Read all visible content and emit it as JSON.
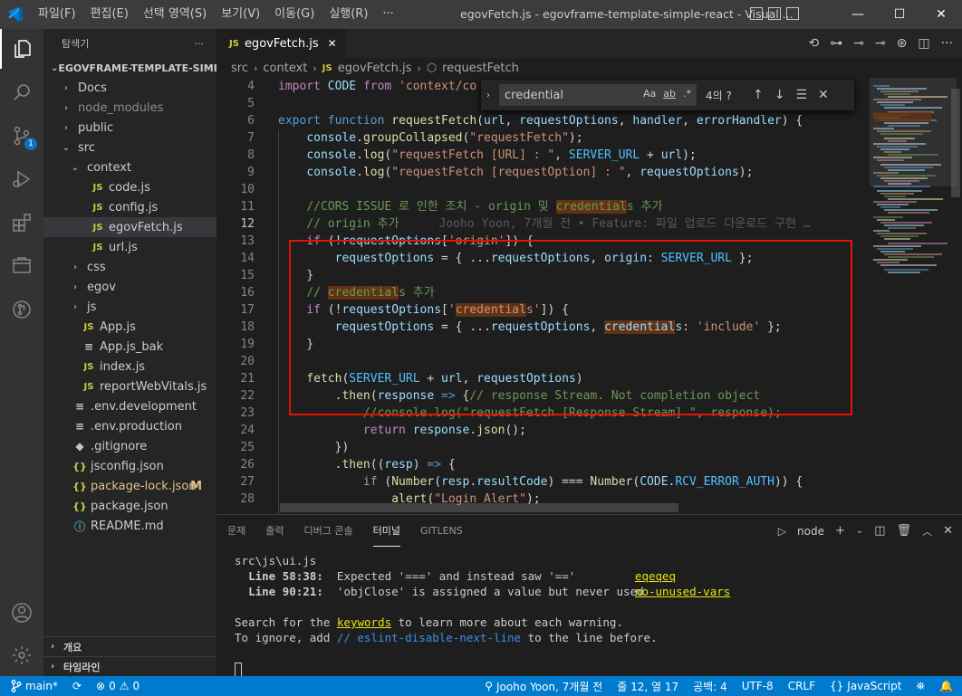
{
  "titlebar": {
    "menu": [
      "파일(F)",
      "편집(E)",
      "선택 영역(S)",
      "보기(V)",
      "이동(G)",
      "실행(R)",
      "···"
    ],
    "title": "egovFetch.js - egovframe-template-simple-react - Visual ...",
    "minimize": "—",
    "maximize": "☐",
    "close": "✕"
  },
  "explorer": {
    "header": "탐색기",
    "more": "···",
    "root": "EGOVFRAME-TEMPLATE-SIMP...",
    "items": [
      {
        "label": "Docs",
        "depth": 1,
        "kind": "folder-closed"
      },
      {
        "label": "node_modules",
        "depth": 1,
        "kind": "folder-closed",
        "dim": true
      },
      {
        "label": "public",
        "depth": 1,
        "kind": "folder-closed"
      },
      {
        "label": "src",
        "depth": 1,
        "kind": "folder-open"
      },
      {
        "label": "context",
        "depth": 2,
        "kind": "folder-open"
      },
      {
        "label": "code.js",
        "depth": 3,
        "kind": "js",
        "icon": "JS"
      },
      {
        "label": "config.js",
        "depth": 3,
        "kind": "js",
        "icon": "JS"
      },
      {
        "label": "egovFetch.js",
        "depth": 3,
        "kind": "js",
        "icon": "JS",
        "selected": true
      },
      {
        "label": "url.js",
        "depth": 3,
        "kind": "js",
        "icon": "JS"
      },
      {
        "label": "css",
        "depth": 2,
        "kind": "folder-closed"
      },
      {
        "label": "egov",
        "depth": 2,
        "kind": "folder-closed"
      },
      {
        "label": "js",
        "depth": 2,
        "kind": "folder-closed"
      },
      {
        "label": "App.js",
        "depth": 2,
        "kind": "js",
        "icon": "JS"
      },
      {
        "label": "App.js_bak",
        "depth": 2,
        "kind": "lines",
        "icon": "≡"
      },
      {
        "label": "index.js",
        "depth": 2,
        "kind": "js",
        "icon": "JS"
      },
      {
        "label": "reportWebVitals.js",
        "depth": 2,
        "kind": "js",
        "icon": "JS"
      },
      {
        "label": ".env.development",
        "depth": 1,
        "kind": "lines",
        "icon": "≡"
      },
      {
        "label": ".env.production",
        "depth": 1,
        "kind": "lines",
        "icon": "≡"
      },
      {
        "label": ".gitignore",
        "depth": 1,
        "kind": "lines",
        "icon": "◆"
      },
      {
        "label": "jsconfig.json",
        "depth": 1,
        "kind": "json",
        "icon": "{}"
      },
      {
        "label": "package-lock.json",
        "depth": 1,
        "kind": "json",
        "icon": "{}",
        "modified": true,
        "mark": "M"
      },
      {
        "label": "package.json",
        "depth": 1,
        "kind": "json",
        "icon": "{}"
      },
      {
        "label": "README.md",
        "depth": 1,
        "kind": "info",
        "icon": "ⓘ"
      }
    ],
    "outline": "개요",
    "timeline": "타임라인"
  },
  "activity": {
    "scm_badge": "1"
  },
  "editor": {
    "tab_icon": "JS",
    "tab_label": "egovFetch.js",
    "tab_close": "✕",
    "breadcrumb": {
      "folder1": "src",
      "folder2": "context",
      "file_icon": "JS",
      "file": "egovFetch.js",
      "symbol_icon": "⬡",
      "symbol": "requestFetch"
    },
    "tab_actions": [
      "⟲",
      "⊶",
      "⊸",
      "⊸",
      "⊛",
      "◫",
      "···"
    ]
  },
  "find": {
    "value": "credential",
    "case": "Aa",
    "word": "ab",
    "regex": ".*",
    "count": "4의 ?",
    "prev": "↑",
    "next": "↓",
    "selection": "☰",
    "close": "✕"
  },
  "code": {
    "lines": [
      {
        "n": "4",
        "html": "<span class='kc'>import</span> <span class='vr'>CODE</span> <span class='kc'>from</span> <span class='st'>'context/co</span>"
      },
      {
        "n": "5",
        "html": ""
      },
      {
        "n": "6",
        "html": "<span class='kw'>export</span> <span class='kw'>function</span> <span class='fn'>requestFetch</span><span class='pl'>(</span><span class='vr'>url</span><span class='pl'>, </span><span class='vr'>requestOptions</span><span class='pl'>, </span><span class='vr'>handler</span><span class='pl'>, </span><span class='vr'>errorHandler</span><span class='pl'>) {</span>"
      },
      {
        "n": "7",
        "html": "    <span class='vr'>console</span><span class='pl'>.</span><span class='fn'>groupCollapsed</span><span class='pl'>(</span><span class='st'>\"requestFetch\"</span><span class='pl'>);</span>"
      },
      {
        "n": "8",
        "html": "    <span class='vr'>console</span><span class='pl'>.</span><span class='fn'>log</span><span class='pl'>(</span><span class='st'>\"requestFetch [URL] : \"</span><span class='pl'>, </span><span class='cn'>SERVER_URL</span><span class='pl'> + </span><span class='vr'>url</span><span class='pl'>);</span>"
      },
      {
        "n": "9",
        "html": "    <span class='vr'>console</span><span class='pl'>.</span><span class='fn'>log</span><span class='pl'>(</span><span class='st'>\"requestFetch [requestOption] : \"</span><span class='pl'>, </span><span class='vr'>requestOptions</span><span class='pl'>);</span>"
      },
      {
        "n": "10",
        "html": ""
      },
      {
        "n": "11",
        "html": "    <span class='cm'>//CORS ISSUE 로 인한 조치 - origin 및 <span class='hl'>credential</span>s 추가</span>"
      },
      {
        "n": "12",
        "html": "    <span class='cm'>// origin 추가</span><span class='blame'>Jooho Yoon, 7개월 전 • Feature: 파일 업로드 다운로드 구현 …</span>",
        "cur": true
      },
      {
        "n": "13",
        "html": "    <span class='kc'>if</span><span class='pl'> (!</span><span class='vr'>requestOptions</span><span class='pl'>[</span><span class='st'>'origin'</span><span class='pl'>]) {</span>"
      },
      {
        "n": "14",
        "html": "        <span class='vr'>requestOptions</span><span class='pl'> = { ...</span><span class='vr'>requestOptions</span><span class='pl'>, </span><span class='vr'>origin</span><span class='pl'>: </span><span class='cn'>SERVER_URL</span><span class='pl'> };</span>"
      },
      {
        "n": "15",
        "html": "    <span class='pl'>}</span>"
      },
      {
        "n": "16",
        "html": "    <span class='cm'>// <span class='hl'>credential</span>s 추가</span>"
      },
      {
        "n": "17",
        "html": "    <span class='kc'>if</span><span class='pl'> (!</span><span class='vr'>requestOptions</span><span class='pl'>[</span><span class='st'>'<span class='hl'>credential</span>s'</span><span class='pl'>]) {</span>"
      },
      {
        "n": "18",
        "html": "        <span class='vr'>requestOptions</span><span class='pl'> = { ...</span><span class='vr'>requestOptions</span><span class='pl'>, </span><span class='vr'><span class='hl'>credential</span>s</span><span class='pl'>: </span><span class='st'>'include'</span><span class='pl'> };</span>"
      },
      {
        "n": "19",
        "html": "    <span class='pl'>}</span>"
      },
      {
        "n": "20",
        "html": ""
      },
      {
        "n": "21",
        "html": "    <span class='fn'>fetch</span><span class='pl'>(</span><span class='cn'>SERVER_URL</span><span class='pl'> + </span><span class='vr'>url</span><span class='pl'>, </span><span class='vr'>requestOptions</span><span class='pl'>)</span>"
      },
      {
        "n": "22",
        "html": "        <span class='pl'>.</span><span class='fn'>then</span><span class='pl'>(</span><span class='vr'>response</span><span class='pl'> </span><span class='kw'>=&gt;</span><span class='pl'> {</span><span class='cm'>// response Stream. Not completion object</span>"
      },
      {
        "n": "23",
        "html": "            <span class='cm'>//console.log(\"requestFetch [Response Stream] \", response);</span>"
      },
      {
        "n": "24",
        "html": "            <span class='kc'>return</span><span class='pl'> </span><span class='vr'>response</span><span class='pl'>.</span><span class='fn'>json</span><span class='pl'>();</span>"
      },
      {
        "n": "25",
        "html": "        <span class='pl'>})</span>"
      },
      {
        "n": "26",
        "html": "        <span class='pl'>.</span><span class='fn'>then</span><span class='pl'>((</span><span class='vr'>resp</span><span class='pl'>) </span><span class='kw'>=&gt;</span><span class='pl'> {</span>"
      },
      {
        "n": "27",
        "html": "            <span class='kc'>if</span><span class='pl'> (</span><span class='fn'>Number</span><span class='pl'>(</span><span class='vr'>resp</span><span class='pl'>.</span><span class='vr'>resultCode</span><span class='pl'>) === </span><span class='fn'>Number</span><span class='pl'>(</span><span class='vr'>CODE</span><span class='pl'>.</span><span class='cn'>RCV_ERROR_AUTH</span><span class='pl'>)) {</span>"
      },
      {
        "n": "28",
        "html": "                <span class='fn'>alert</span><span class='pl'>(</span><span class='st'>\"Login Alert\"</span><span class='pl'>);</span>"
      }
    ]
  },
  "panel": {
    "tabs": [
      "문제",
      "출력",
      "디버그 콘솔",
      "터미널",
      "GITLENS"
    ],
    "active_tab": "터미널",
    "terminal_name": "node",
    "terminal": {
      "file": "src\\js\\ui.js",
      "w1_loc": "Line 58:38:",
      "w1_msg": "Expected '===' and instead saw '=='",
      "w1_rule": "eqeqeq",
      "w2_loc": "Line 90:21:",
      "w2_msg": "'objClose' is assigned a value but never used",
      "w2_rule": "no-unused-vars",
      "search_pre": "Search for the ",
      "search_kw": "keywords",
      "search_post": " to learn more about each warning.",
      "ignore_pre": "To ignore, add ",
      "ignore_kw": "// eslint-disable-next-line",
      "ignore_post": " to the line before."
    }
  },
  "status": {
    "branch": "main*",
    "sync": "⟳",
    "errors": "0",
    "warnings": "0",
    "blame": "Jooho Yoon, 7개월 전",
    "position": "줄 12, 열 17",
    "spaces": "공백: 4",
    "encoding": "UTF-8",
    "eol": "CRLF",
    "language": "JavaScript"
  },
  "colors": {
    "accent": "#007acc",
    "find_highlight": "#613214",
    "annotation_box": "#e51400",
    "modified": "#e2c08d"
  }
}
